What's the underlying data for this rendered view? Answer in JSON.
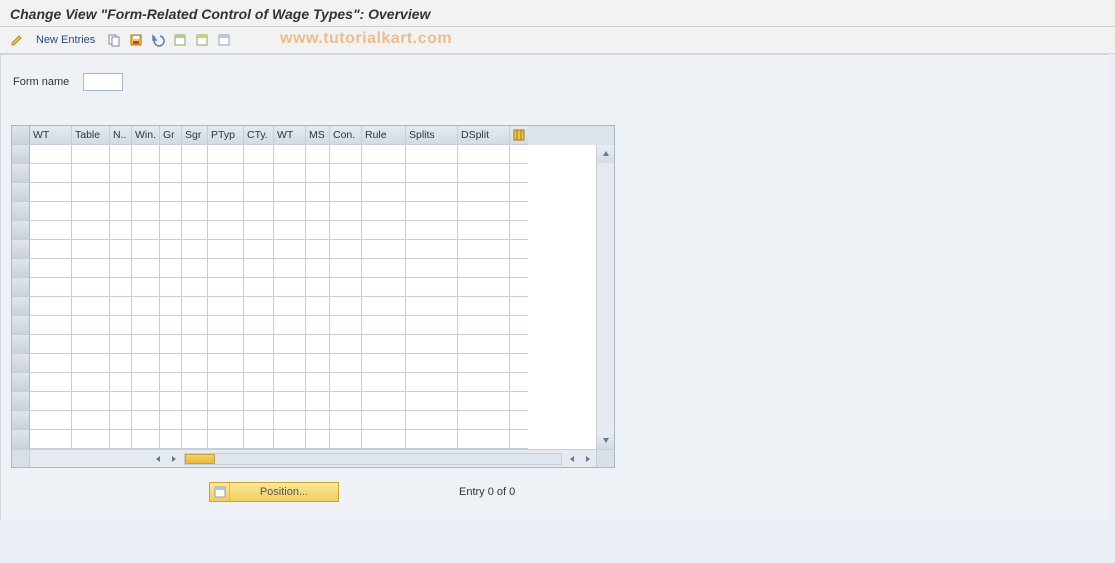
{
  "title": "Change View \"Form-Related Control of Wage Types\": Overview",
  "toolbar": {
    "new_entries": "New Entries"
  },
  "watermark": "www.tutorialkart.com",
  "form": {
    "name_label": "Form name",
    "name_value": ""
  },
  "table": {
    "columns": [
      "WT",
      "Table",
      "N..",
      "Win.",
      "Gr",
      "Sgr",
      "PTyp",
      "CTy.",
      "WT",
      "MS",
      "Con.",
      "Rule",
      "Splits",
      "DSplit"
    ],
    "rows": 16
  },
  "footer": {
    "position_label": "Position...",
    "entry_text": "Entry 0 of 0"
  }
}
